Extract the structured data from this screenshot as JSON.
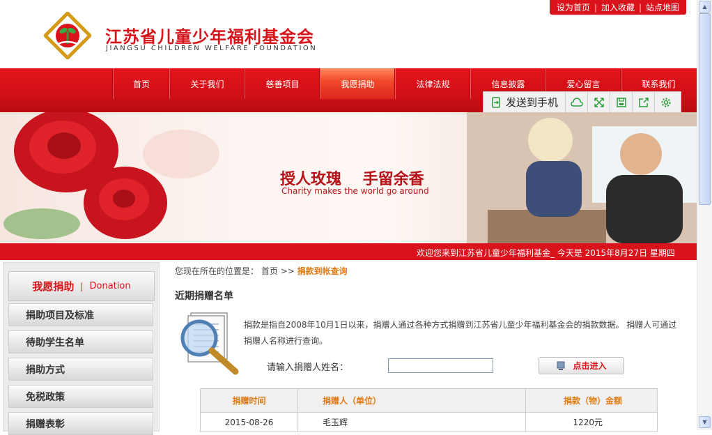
{
  "top_links": [
    "设为首页",
    "加入收藏",
    "站点地图"
  ],
  "logo": {
    "cn": "江苏省儿童少年福利基金会",
    "en": "JIANGSU CHILDREN WELFARE FOUNDATION"
  },
  "nav": [
    {
      "label": "首页",
      "active": false
    },
    {
      "label": "关于我们",
      "active": false
    },
    {
      "label": "慈善项目",
      "active": false
    },
    {
      "label": "我愿捐助",
      "active": true
    },
    {
      "label": "法律法规",
      "active": false
    },
    {
      "label": "信息披露",
      "active": false
    },
    {
      "label": "爱心留言",
      "active": false
    },
    {
      "label": "联系我们",
      "active": false
    }
  ],
  "send_bar": {
    "label": "发送到手机",
    "tools": [
      "cloud-icon",
      "expand-icon",
      "save-icon",
      "share-icon",
      "settings-icon"
    ]
  },
  "banner": {
    "title_a": "授人玫瑰",
    "title_b": "手留余香",
    "subtitle": "Charity makes the world go around"
  },
  "welcome": "欢迎您来到江苏省儿童少年福利基金_ 今天是 2015年8月27日 星期四",
  "sidebar": {
    "heading_cn": "我愿捐助",
    "heading_sep": "|",
    "heading_en": "Donation",
    "items": [
      "捐助项目及标准",
      "待助学生名单",
      "捐助方式",
      "免税政策",
      "捐赠表彰"
    ]
  },
  "breadcrumb": {
    "prefix": "您现在所在的位置是：",
    "home": "首页",
    "sep": ">>",
    "current": "捐款到帐查询"
  },
  "section_title": "近期捐赠名单",
  "description": "捐款是指自2008年10月1日以来，捐赠人通过各种方式捐赠到江苏省儿童少年福利基金会的捐款数据。 捐赠人可通过捐赠人名称进行查询。",
  "query": {
    "label": "请输入捐赠人姓名：",
    "value": "",
    "button": "点击进入"
  },
  "table": {
    "headers": [
      "捐赠时间",
      "捐赠人（单位）",
      "捐款（物）金额"
    ],
    "rows": [
      [
        "2015-08-26",
        "毛玉辉",
        "1220元"
      ]
    ]
  },
  "colors": {
    "brand_red": "#d9121b",
    "accent_orange": "#e07b14"
  }
}
